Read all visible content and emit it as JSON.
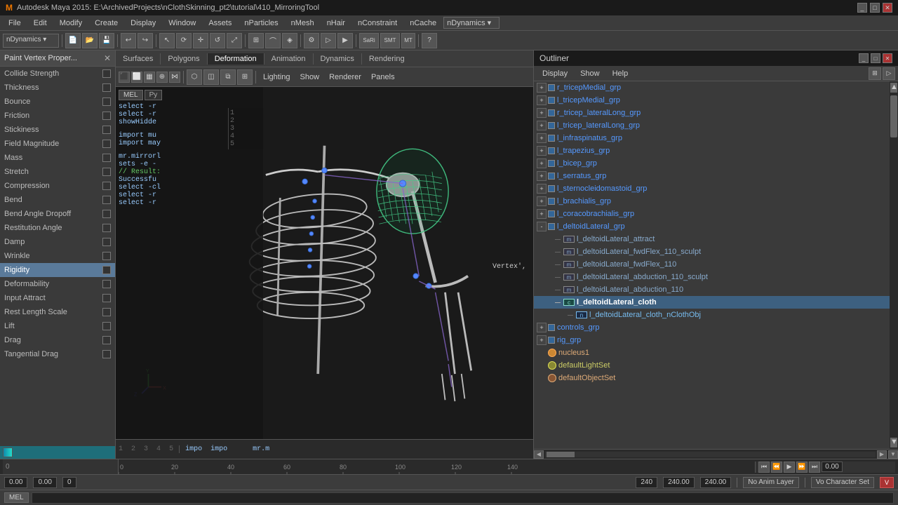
{
  "app": {
    "title": "Autodesk Maya 2015: E:\\ArchivedProjects\\nClothSkinning_pt2\\tutorial\\410_MirroringTool"
  },
  "outliner": {
    "title": "Outliner",
    "menu": [
      "Display",
      "Show",
      "Help"
    ],
    "items": [
      {
        "id": "r_tricepMedial_grp",
        "label": "r_tricepMedial_grp",
        "indent": 0,
        "type": "grp",
        "expand": true
      },
      {
        "id": "l_tricepMedial_grp",
        "label": "l_tricepMedial_grp",
        "indent": 0,
        "type": "grp",
        "expand": true
      },
      {
        "id": "r_tricep_lateralLong_grp",
        "label": "r_tricep_lateralLong_grp",
        "indent": 0,
        "type": "grp",
        "expand": true
      },
      {
        "id": "l_tricep_lateralLong_grp",
        "label": "l_tricep_lateralLong_grp",
        "indent": 0,
        "type": "grp",
        "expand": true
      },
      {
        "id": "l_infraspinatus_grp",
        "label": "l_infraspinatus_grp",
        "indent": 0,
        "type": "grp",
        "expand": true
      },
      {
        "id": "l_trapezius_grp",
        "label": "l_trapezius_grp",
        "indent": 0,
        "type": "grp",
        "expand": true
      },
      {
        "id": "l_bicep_grp",
        "label": "l_bicep_grp",
        "indent": 0,
        "type": "grp",
        "expand": true
      },
      {
        "id": "l_serratus_grp",
        "label": "l_serratus_grp",
        "indent": 0,
        "type": "grp",
        "expand": true
      },
      {
        "id": "l_sternocleidomastoid_grp",
        "label": "l_sternocleidomastoid_grp",
        "indent": 0,
        "type": "grp",
        "expand": true
      },
      {
        "id": "l_brachialis_grp",
        "label": "l_brachialis_grp",
        "indent": 0,
        "type": "grp",
        "expand": true
      },
      {
        "id": "l_coracobrachialis_grp",
        "label": "l_coracobrachialis_grp",
        "indent": 0,
        "type": "grp",
        "expand": true
      },
      {
        "id": "l_deltoidLateral_grp",
        "label": "l_deltoidLateral_grp",
        "indent": 0,
        "type": "grp",
        "expand": true,
        "expanded": true
      },
      {
        "id": "l_deltoidLateral_attract",
        "label": "l_deltoidLateral_attract",
        "indent": 1,
        "type": "mesh"
      },
      {
        "id": "l_deltoidLateral_fwdFlex_110_sculpt",
        "label": "l_deltoidLateral_fwdFlex_110_sculpt",
        "indent": 1,
        "type": "mesh"
      },
      {
        "id": "l_deltoidLateral_fwdFlex_110",
        "label": "l_deltoidLateral_fwdFlex_110",
        "indent": 1,
        "type": "mesh"
      },
      {
        "id": "l_deltoidLateral_abduction_110_sculpt",
        "label": "l_deltoidLateral_abduction_110_sculpt",
        "indent": 1,
        "type": "mesh"
      },
      {
        "id": "l_deltoidLateral_abduction_110",
        "label": "l_deltoidLateral_abduction_110",
        "indent": 1,
        "type": "mesh"
      },
      {
        "id": "l_deltoidLateral_cloth",
        "label": "l_deltoidLateral_cloth",
        "indent": 1,
        "type": "cloth",
        "selected": true
      },
      {
        "id": "l_deltoidLateral_cloth_nClothObj",
        "label": "l_deltoidLateral_cloth_nClothObj",
        "indent": 2,
        "type": "ncloth"
      },
      {
        "id": "controls_grp",
        "label": "controls_grp",
        "indent": 0,
        "type": "grp",
        "expand": true
      },
      {
        "id": "rig_grp",
        "label": "rig_grp",
        "indent": 0,
        "type": "grp",
        "expand": true
      },
      {
        "id": "nucleus1",
        "label": "nucleus1",
        "indent": 0,
        "type": "obj"
      },
      {
        "id": "defaultLightSet",
        "label": "defaultLightSet",
        "indent": 0,
        "type": "light"
      },
      {
        "id": "defaultObjectSet",
        "label": "defaultObjectSet",
        "indent": 0,
        "type": "obj"
      }
    ]
  },
  "left_panel": {
    "title": "Paint Vertex Proper...",
    "items": [
      {
        "label": "Collide Strength",
        "checked": false
      },
      {
        "label": "Thickness",
        "checked": false
      },
      {
        "label": "Bounce",
        "checked": false
      },
      {
        "label": "Friction",
        "checked": false
      },
      {
        "label": "Stickiness",
        "checked": false
      },
      {
        "label": "Field Magnitude",
        "checked": false
      },
      {
        "label": "Mass",
        "checked": false
      },
      {
        "label": "Stretch",
        "checked": false
      },
      {
        "label": "Compression",
        "checked": false
      },
      {
        "label": "Bend",
        "checked": false
      },
      {
        "label": "Bend Angle Dropoff",
        "checked": false
      },
      {
        "label": "Restitution Angle",
        "checked": false
      },
      {
        "label": "Damp",
        "checked": false
      },
      {
        "label": "Wrinkle",
        "checked": false
      },
      {
        "label": "Rigidity",
        "checked": false,
        "selected": true
      },
      {
        "label": "Deformability",
        "checked": false
      },
      {
        "label": "Input Attract",
        "checked": false
      },
      {
        "label": "Rest Length Scale",
        "checked": false
      },
      {
        "label": "Lift",
        "checked": false
      },
      {
        "label": "Drag",
        "checked": false
      },
      {
        "label": "Tangential Drag",
        "checked": false
      }
    ]
  },
  "menubar": {
    "items": [
      "File",
      "Edit",
      "Modify",
      "Create",
      "Display",
      "Window",
      "Assets",
      "nParticles",
      "nMesh",
      "nHair",
      "nConstraint",
      "nCache"
    ]
  },
  "viewport_tabs": [
    "Surfaces",
    "Polygons",
    "Deformation",
    "Animation",
    "Dynamics",
    "Rendering"
  ],
  "viewport_toolbar2_items": [
    "Lighting",
    "Show",
    "Renderer",
    "Panels"
  ],
  "script_lines": [
    {
      "num": "",
      "text": "select -r"
    },
    {
      "num": "",
      "text": "select -r"
    },
    {
      "num": "",
      "text": "showHidde"
    },
    {
      "num": "",
      "text": ""
    },
    {
      "num": "",
      "text": "import mu"
    },
    {
      "num": "",
      "text": "import may"
    },
    {
      "num": "",
      "text": ""
    },
    {
      "num": "",
      "text": "mr.mirrorl"
    },
    {
      "num": "",
      "text": "sets -e -"
    },
    {
      "num": "",
      "text": "// Result:"
    },
    {
      "num": "",
      "text": "Successfu"
    },
    {
      "num": "",
      "text": "select -cl"
    },
    {
      "num": "",
      "text": "select -r"
    },
    {
      "num": "",
      "text": "select -r"
    }
  ],
  "code_lines": [
    "1",
    "2",
    "3",
    "4",
    "5"
  ],
  "code_texts": [
    "impo",
    "impo",
    "",
    "",
    "mr.m"
  ],
  "timeline": {
    "ticks": [
      "0",
      "20",
      "40",
      "60",
      "80",
      "100",
      "120",
      "140"
    ]
  },
  "status_bar": {
    "time1": "0.00",
    "time2": "0.00",
    "frame": "0",
    "val1": "240",
    "val2": "240.00",
    "val3": "240.00",
    "anim_layer": "No Anim Layer",
    "char_set_prefix": "Vo Character Set"
  },
  "mel_label": "MEL",
  "vertex_text": "Vertex',"
}
